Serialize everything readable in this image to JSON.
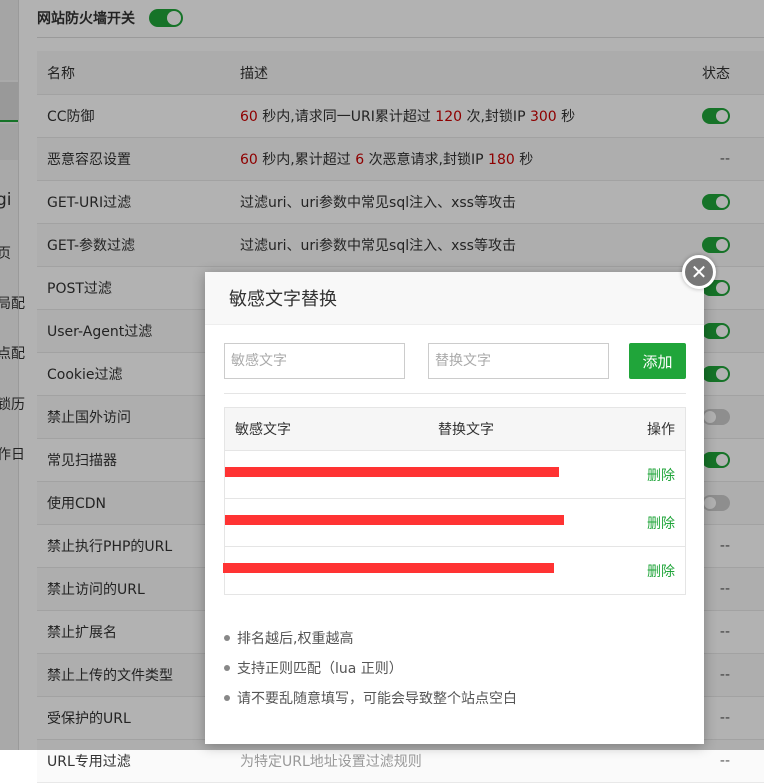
{
  "firewall": {
    "title": "网站防火墙开关",
    "enabled": true
  },
  "left_fragments": [
    "gi",
    "页",
    "局配",
    "点配",
    "锁历",
    "作日"
  ],
  "rules_table": {
    "headers": {
      "name": "名称",
      "desc": "描述",
      "status": "状态"
    },
    "rows": [
      {
        "name": "CC防御",
        "desc_parts": [
          "60",
          "秒内,请求同一URI累计超过",
          "120",
          "次,封锁IP",
          "300",
          "秒"
        ],
        "status": "on"
      },
      {
        "name": "恶意容忍设置",
        "desc_parts": [
          "60",
          "秒内,累计超过",
          "6",
          "次恶意请求,封锁IP",
          "180",
          "秒"
        ],
        "status": "--"
      },
      {
        "name": "GET-URI过滤",
        "desc": "过滤uri、uri参数中常见sql注入、xss等攻击",
        "status": "on"
      },
      {
        "name": "GET-参数过滤",
        "desc": "过滤uri、uri参数中常见sql注入、xss等攻击",
        "status": "on"
      },
      {
        "name": "POST过滤",
        "desc": "",
        "status": "on"
      },
      {
        "name": "User-Agent过滤",
        "desc": "",
        "status": "on"
      },
      {
        "name": "Cookie过滤",
        "desc": "",
        "status": "on"
      },
      {
        "name": "禁止国外访问",
        "desc": "",
        "status": "off"
      },
      {
        "name": "常见扫描器",
        "desc": "",
        "status": "on"
      },
      {
        "name": "使用CDN",
        "desc": "",
        "status": "off"
      },
      {
        "name": "禁止执行PHP的URL",
        "desc": "",
        "status": "--"
      },
      {
        "name": "禁止访问的URL",
        "desc": "",
        "status": "--"
      },
      {
        "name": "禁止扩展名",
        "desc": "",
        "status": "--"
      },
      {
        "name": "禁止上传的文件类型",
        "desc": "",
        "status": "--"
      },
      {
        "name": "受保护的URL",
        "desc": "",
        "status": "--"
      },
      {
        "name": "URL专用过滤",
        "desc": "为特定URL地址设置过滤规则",
        "status": "--"
      }
    ]
  },
  "modal": {
    "title": "敏感文字替换",
    "close_symbol": "✕",
    "sensitive_placeholder": "敏感文字",
    "replace_placeholder": "替换文字",
    "add_label": "添加",
    "table_headers": {
      "sensitive": "敏感文字",
      "replace": "替换文字",
      "action": "操作"
    },
    "rows": [
      {
        "delete_label": "删除"
      },
      {
        "delete_label": "删除"
      },
      {
        "delete_label": "删除"
      }
    ],
    "tips": [
      "排名越后,权重越高",
      "支持正则匹配（lua 正则）",
      "请不要乱随意填写，可能会导致整个站点空白"
    ]
  },
  "colors": {
    "accent": "#20a53a",
    "danger_text": "#cc0000",
    "redaction": "#ff3333"
  }
}
